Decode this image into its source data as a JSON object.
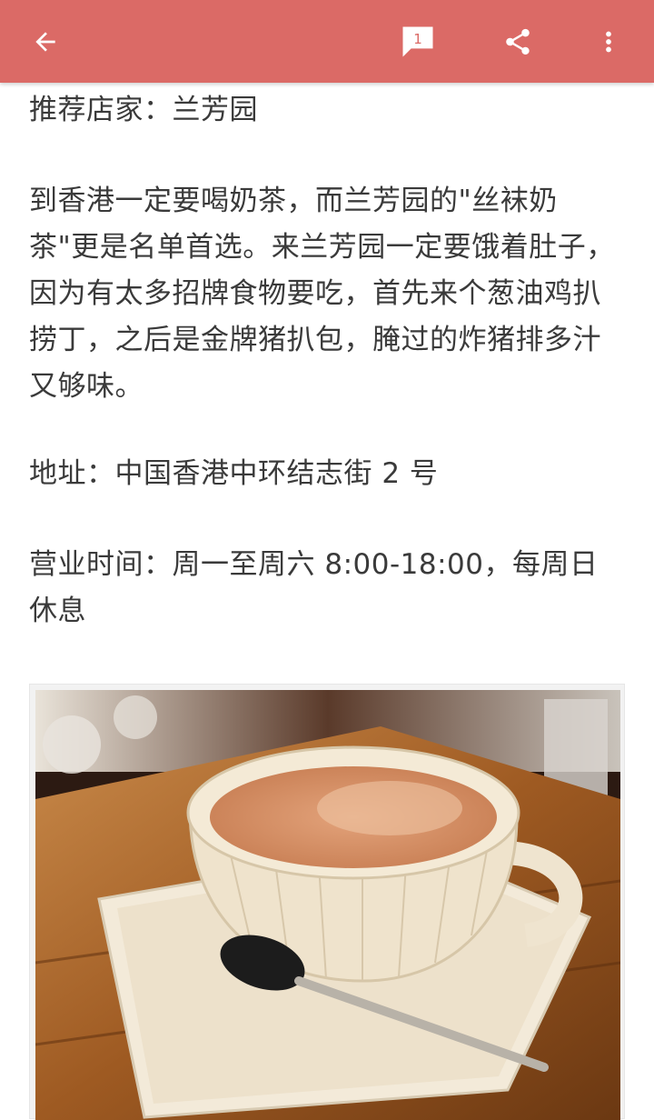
{
  "appbar": {
    "comment_count": "1",
    "icons": [
      "arrow-back-icon",
      "comment-icon",
      "share-icon",
      "more-vert-icon"
    ],
    "background": "#db6a66"
  },
  "article": {
    "paragraphs": [
      "推荐店家：兰芳园",
      "到香港一定要喝奶茶，而兰芳园的\"丝袜奶茶\"更是名单首选。来兰芳园一定要饿着肚子，因为有太多招牌食物要吃，首先来个葱油鸡扒捞丁，之后是金牌猪扒包，腌过的炸猪排多汁又够味。",
      "地址：中国香港中环结志街 2 号",
      "营业时间：周一至周六 8:00-18:00，每周日休息"
    ]
  },
  "image": {
    "subject": "cup of milk tea on a saucer with spoon"
  }
}
